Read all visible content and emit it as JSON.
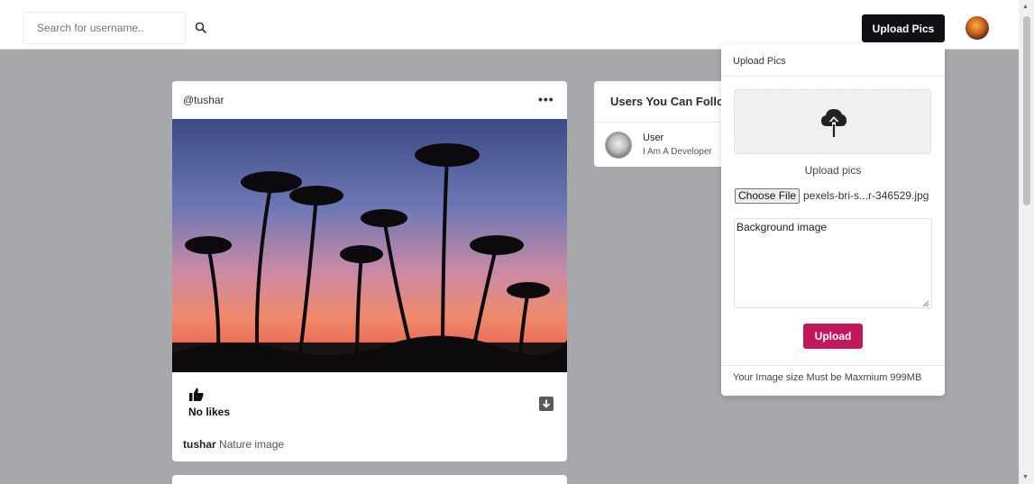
{
  "header": {
    "search_placeholder": "Search for username..",
    "upload_button": "Upload Pics"
  },
  "post": {
    "username": "@tushar",
    "likes_text": "No likes",
    "caption_user": "tushar",
    "caption_text": "Nature image"
  },
  "suggestions": {
    "title": "Users You Can Follow",
    "users": [
      {
        "name": "User",
        "bio": "I Am A Developer"
      }
    ]
  },
  "upload_panel": {
    "header": "Upload Pics",
    "drop_label": "Upload pics",
    "choose_button": "Choose File",
    "file_name": "pexels-bri-s...r-346529.jpg",
    "description_value": "Background image",
    "upload_button": "Upload",
    "footer_note": "Your Image size Must be Maxmium 999MB"
  },
  "colors": {
    "page_bg": "#a7a8ab",
    "upload_btn": "#c2185b",
    "top_btn": "#0f0f14"
  },
  "icons": {
    "search": "search-icon",
    "more": "more-options-icon",
    "like": "thumbs-up-icon",
    "download": "download-icon",
    "cloud": "cloud-upload-icon"
  }
}
